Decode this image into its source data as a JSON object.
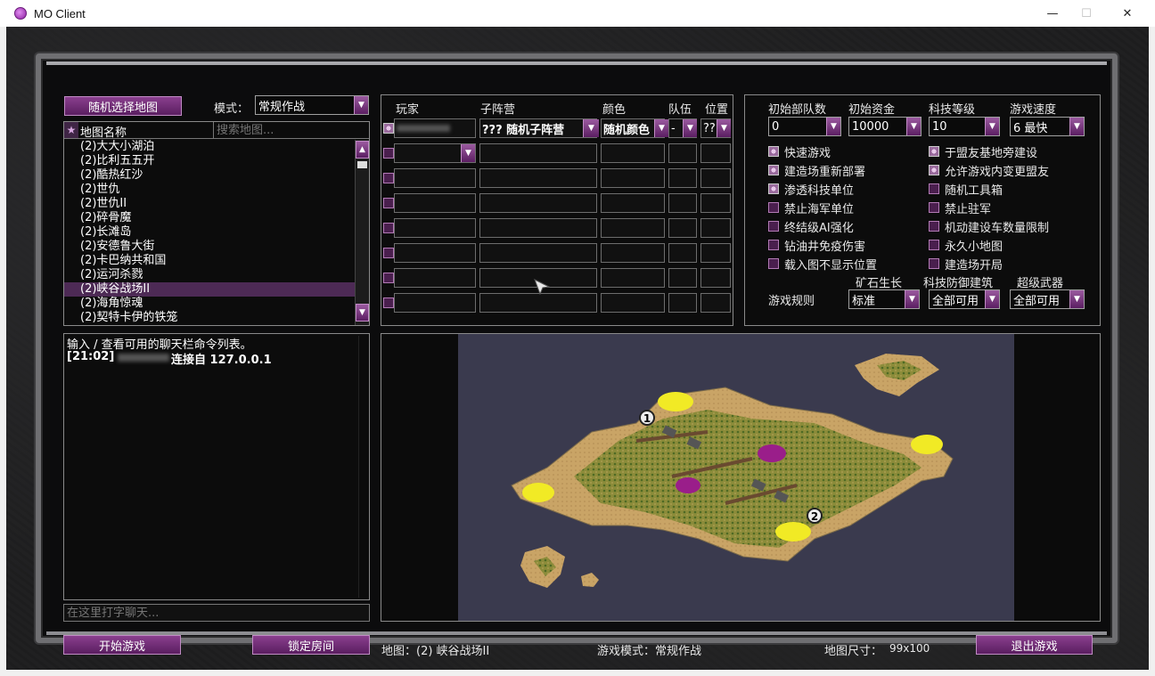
{
  "window": {
    "title": "MO Client",
    "minimize": "—",
    "maximize": "☐",
    "close": "✕"
  },
  "left": {
    "random_map_button": "随机选择地图",
    "mode_label": "模式：",
    "mode_value": "常规作战",
    "star": "★",
    "map_name_header": "地图名称",
    "search_placeholder": "搜索地图...",
    "maps": [
      "(2)大大小湖泊",
      "(2)比利五五开",
      "(2)酷热红沙",
      "(2)世仇",
      "(2)世仇II",
      "(2)碎骨魔",
      "(2)长滩岛",
      "(2)安德鲁大街",
      "(2)卡巴纳共和国",
      "(2)运河杀戮",
      "(2)峡谷战场II",
      "(2)海角惊魂",
      "(2)契特卡伊的铁笼"
    ],
    "selected_index": 10
  },
  "players": {
    "headers": {
      "player": "玩家",
      "subfaction": "子阵营",
      "color": "颜色",
      "team": "队伍",
      "position": "位置"
    },
    "row1": {
      "subfaction": "??? 随机子阵营",
      "color": "随机颜色",
      "team": "-",
      "position": "??"
    }
  },
  "options": {
    "starting_units_label": "初始部队数",
    "starting_units": "0",
    "funds_label": "初始资金",
    "funds": "10000",
    "tech_label": "科技等级",
    "tech": "10",
    "speed_label": "游戏速度",
    "speed": "6 最快",
    "checkboxes_left": [
      {
        "label": "快速游戏",
        "checked": true
      },
      {
        "label": "建造场重新部署",
        "checked": true
      },
      {
        "label": "渗透科技单位",
        "checked": true
      },
      {
        "label": "禁止海军单位",
        "checked": false
      },
      {
        "label": "终结级AI强化",
        "checked": false
      },
      {
        "label": "钻油井免疫伤害",
        "checked": false
      },
      {
        "label": "载入图不显示位置",
        "checked": false
      }
    ],
    "checkboxes_right": [
      {
        "label": "于盟友基地旁建设",
        "checked": true
      },
      {
        "label": "允许游戏内变更盟友",
        "checked": true
      },
      {
        "label": "随机工具箱",
        "checked": false
      },
      {
        "label": "禁止驻军",
        "checked": false
      },
      {
        "label": "机动建设车数量限制",
        "checked": false
      },
      {
        "label": "永久小地图",
        "checked": false
      },
      {
        "label": "建造场开局",
        "checked": false
      }
    ],
    "rules_label": "游戏规则",
    "ore_label": "矿石生长",
    "ore": "标准",
    "defense_label": "科技防御建筑",
    "defense": "全部可用",
    "super_label": "超级武器",
    "super": "全部可用"
  },
  "chat": {
    "line1": "输入 / 查看可用的聊天栏命令列表。",
    "line2_time": "[21:02]",
    "line2_text": "连接自 127.0.0.1",
    "input_placeholder": "在这里打字聊天..."
  },
  "bottom": {
    "start_button": "开始游戏",
    "lock_button": "锁定房间",
    "map_info": "地图：(2) 峡谷战场II",
    "mode_info": "游戏模式：常规作战",
    "size_label": "地图尺寸：",
    "size_value": "99x100",
    "exit_button": "退出游戏"
  },
  "preview": {
    "start1": "1",
    "start2": "2"
  }
}
